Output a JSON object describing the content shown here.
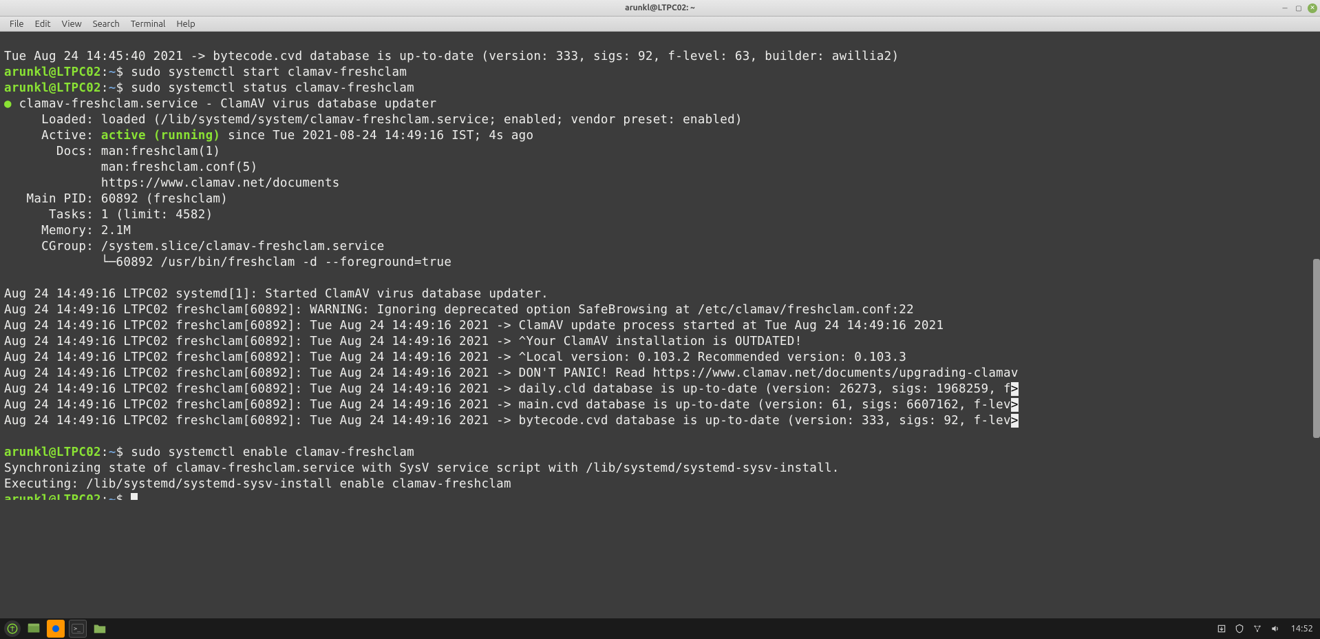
{
  "titlebar": {
    "title": "arunkl@LTPC02: ~"
  },
  "menu": {
    "file": "File",
    "edit": "Edit",
    "view": "View",
    "search": "Search",
    "terminal": "Terminal",
    "help": "Help"
  },
  "prompt": {
    "user_host": "arunkl@LTPC02",
    "colon": ":",
    "path": "~",
    "dollar": "$"
  },
  "term": {
    "l1": "Tue Aug 24 14:45:40 2021 -> bytecode.cvd database is up-to-date (version: 333, sigs: 92, f-level: 63, builder: awillia2)",
    "cmd1": " sudo systemctl start clamav-freshclam",
    "cmd2": " sudo systemctl status clamav-freshclam",
    "bullet": "●",
    "svc_header": " clamav-freshclam.service - ClamAV virus database updater",
    "loaded": "     Loaded: loaded (/lib/systemd/system/clamav-freshclam.service; enabled; vendor preset: enabled)",
    "active_label": "     Active: ",
    "active_val": "active (running)",
    "active_rest": " since Tue 2021-08-24 14:49:16 IST; 4s ago",
    "docs1": "       Docs: man:freshclam(1)",
    "docs2": "             man:freshclam.conf(5)",
    "docs3": "             https://www.clamav.net/documents",
    "mainpid": "   Main PID: 60892 (freshclam)",
    "tasks": "      Tasks: 1 (limit: 4582)",
    "memory": "     Memory: 2.1M",
    "cgroup": "     CGroup: /system.slice/clamav-freshclam.service",
    "cgroup2": "             └─60892 /usr/bin/freshclam -d --foreground=true",
    "log1": "Aug 24 14:49:16 LTPC02 systemd[1]: Started ClamAV virus database updater.",
    "log2": "Aug 24 14:49:16 LTPC02 freshclam[60892]: WARNING: Ignoring deprecated option SafeBrowsing at /etc/clamav/freshclam.conf:22",
    "log3": "Aug 24 14:49:16 LTPC02 freshclam[60892]: Tue Aug 24 14:49:16 2021 -> ClamAV update process started at Tue Aug 24 14:49:16 2021",
    "log4": "Aug 24 14:49:16 LTPC02 freshclam[60892]: Tue Aug 24 14:49:16 2021 -> ^Your ClamAV installation is OUTDATED!",
    "log5": "Aug 24 14:49:16 LTPC02 freshclam[60892]: Tue Aug 24 14:49:16 2021 -> ^Local version: 0.103.2 Recommended version: 0.103.3",
    "log6": "Aug 24 14:49:16 LTPC02 freshclam[60892]: Tue Aug 24 14:49:16 2021 -> DON'T PANIC! Read https://www.clamav.net/documents/upgrading-clamav",
    "log7a": "Aug 24 14:49:16 LTPC02 freshclam[60892]: Tue Aug 24 14:49:16 2021 -> daily.cld database is up-to-date (version: 26273, sigs: 1968259, f",
    "log7b": ">",
    "log8a": "Aug 24 14:49:16 LTPC02 freshclam[60892]: Tue Aug 24 14:49:16 2021 -> main.cvd database is up-to-date (version: 61, sigs: 6607162, f-lev",
    "log8b": ">",
    "log9a": "Aug 24 14:49:16 LTPC02 freshclam[60892]: Tue Aug 24 14:49:16 2021 -> bytecode.cvd database is up-to-date (version: 333, sigs: 92, f-lev",
    "log9b": ">",
    "cmd3": " sudo systemctl enable clamav-freshclam",
    "sync1": "Synchronizing state of clamav-freshclam.service with SysV service script with /lib/systemd/systemd-sysv-install.",
    "sync2": "Executing: /lib/systemd/systemd-sysv-install enable clamav-freshclam"
  },
  "taskbar": {
    "clock": "14:52"
  }
}
